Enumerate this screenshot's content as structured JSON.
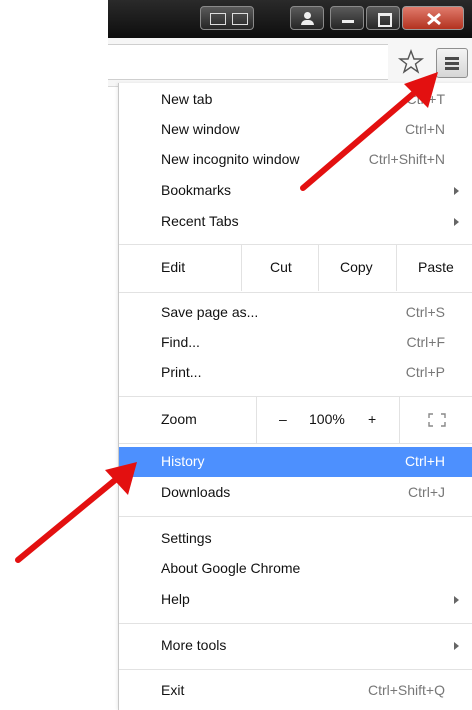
{
  "menu": {
    "items_top": [
      {
        "label": "New tab",
        "shortcut": "Ctrl+T"
      },
      {
        "label": "New window",
        "shortcut": "Ctrl+N"
      },
      {
        "label": "New incognito window",
        "shortcut": "Ctrl+Shift+N"
      },
      {
        "label": "Bookmarks",
        "shortcut": ""
      },
      {
        "label": "Recent Tabs",
        "shortcut": ""
      }
    ],
    "edit": {
      "label": "Edit",
      "cut": "Cut",
      "copy": "Copy",
      "paste": "Paste"
    },
    "items_page": [
      {
        "label": "Save page as...",
        "shortcut": "Ctrl+S"
      },
      {
        "label": "Find...",
        "shortcut": "Ctrl+F"
      },
      {
        "label": "Print...",
        "shortcut": "Ctrl+P"
      }
    ],
    "zoom": {
      "label": "Zoom",
      "minus": "–",
      "level": "100%",
      "plus": "+"
    },
    "items_history": [
      {
        "label": "History",
        "shortcut": "Ctrl+H"
      },
      {
        "label": "Downloads",
        "shortcut": "Ctrl+J"
      }
    ],
    "items_settings": [
      {
        "label": "Settings"
      },
      {
        "label": "About Google Chrome"
      },
      {
        "label": "Help"
      }
    ],
    "more_tools": {
      "label": "More tools"
    },
    "exit": {
      "label": "Exit",
      "shortcut": "Ctrl+Shift+Q"
    }
  },
  "colors": {
    "highlight": "#4d90fe",
    "annotation_arrow": "#e31010",
    "titlebar": "#1a1a1a",
    "close_button": "#c8443a"
  },
  "icons": {
    "star": "star-outline-icon",
    "menu": "hamburger-menu-icon"
  }
}
